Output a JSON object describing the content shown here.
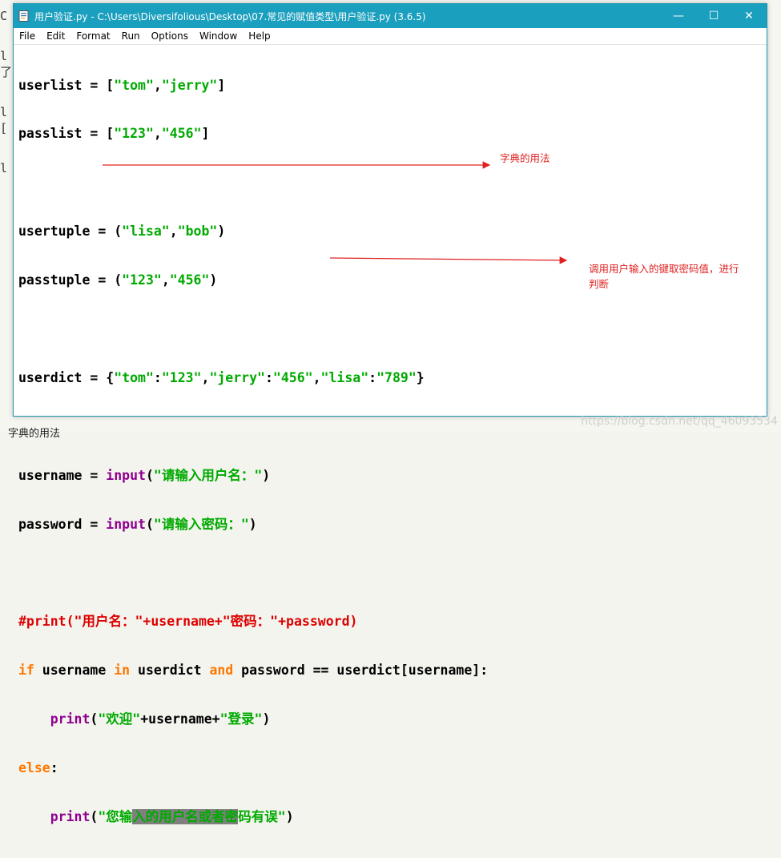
{
  "window": {
    "title": "用户验证.py - C:\\Users\\Diversifolious\\Desktop\\07.常见的赋值类型\\用户验证.py (3.6.5)",
    "controls": {
      "minimize": "—",
      "maximize": "☐",
      "close": "✕"
    }
  },
  "menu": [
    "File",
    "Edit",
    "Format",
    "Run",
    "Options",
    "Window",
    "Help"
  ],
  "code": {
    "line1": {
      "a": "userlist = [",
      "s1": "\"tom\"",
      "b": ",",
      "s2": "\"jerry\"",
      "c": "]"
    },
    "line2": {
      "a": "passlist = [",
      "s1": "\"123\"",
      "b": ",",
      "s2": "\"456\"",
      "c": "]"
    },
    "line4": {
      "a": "usertuple = (",
      "s1": "\"lisa\"",
      "b": ",",
      "s2": "\"bob\"",
      "c": ")"
    },
    "line5": {
      "a": "passtuple = (",
      "s1": "\"123\"",
      "b": ",",
      "s2": "\"456\"",
      "c": ")"
    },
    "line7": {
      "a": "userdict = {",
      "s1": "\"tom\"",
      "b": ":",
      "s2": "\"123\"",
      "c": ",",
      "s3": "\"jerry\"",
      "d": ":",
      "s4": "\"456\"",
      "e": ",",
      "s5": "\"lisa\"",
      "f": ":",
      "s6": "\"789\"",
      "g": "}"
    },
    "line9": {
      "a": "username = ",
      "bi": "input",
      "b": "(",
      "s1": "\"请输入用户名：\"",
      "c": ")"
    },
    "line10": {
      "a": "password = ",
      "bi": "input",
      "b": "(",
      "s1": "\"请输入密码：\"",
      "c": ")"
    },
    "line12": {
      "comment": "#print(\"用户名：\"+username+\"密码：\"+password)"
    },
    "line13": {
      "kw1": "if",
      "a": " username ",
      "kw2": "in",
      "b": " userdict ",
      "kw3": "and",
      "c": " password == userdict[username]:"
    },
    "line14": {
      "indent": "    ",
      "bi": "print",
      "a": "(",
      "s1": "\"欢迎\"",
      "b": "+username+",
      "s2": "\"登录\"",
      "c": ")"
    },
    "line15": {
      "kw": "else",
      "a": ":"
    },
    "line16": {
      "indent": "    ",
      "bi": "print",
      "a": "(",
      "s1": "\"您输",
      "sel": "入的用户名或者密",
      "s2": "码有误\"",
      "c": ")"
    }
  },
  "annotations": {
    "dict_usage": "字典的用法",
    "lookup_line1": "调用用户输入的键取密码值，进行",
    "lookup_line2": "判断"
  },
  "background": {
    "bottom_text": "字典的用法",
    "left_glyphs": [
      "C",
      "l",
      "了",
      "l",
      "[",
      "l"
    ]
  },
  "watermark": "https://blog.csdn.net/qq_46093534",
  "colors": {
    "titlebar": "#1b9fbe",
    "keyword": "#ff7700",
    "builtin": "#900090",
    "string": "#00aa00",
    "comment": "#dd0000",
    "annotation": "#e02020"
  }
}
